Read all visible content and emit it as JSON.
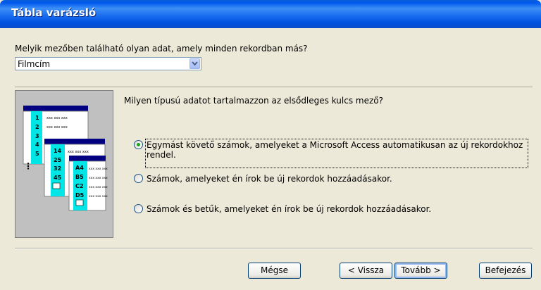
{
  "window": {
    "title": "Tábla varázsló"
  },
  "prompt": {
    "label": "Melyik mezőben található olyan adat, amely minden rekordban más?"
  },
  "field_select": {
    "value": "Filmcím"
  },
  "question": {
    "label": "Milyen típusú adatot tartalmazzon az elsődleges kulcs mező?"
  },
  "options": [
    {
      "line1": "Egymást követő számok, amelyeket a Microsoft Access automatikusan az új rekordokhoz",
      "line2": "rendel.",
      "selected": true
    },
    {
      "label": "Számok, amelyeket én írok be új rekordok hozzáadásakor.",
      "selected": false
    },
    {
      "label": "Számok és betűk, amelyeket én írok be új rekordok hozzáadásakor.",
      "selected": false
    }
  ],
  "illustration": {
    "t1": [
      "1",
      "2",
      "3",
      "4",
      "5"
    ],
    "t2": [
      "14",
      "25",
      "32",
      "45"
    ],
    "t3": [
      "A4",
      "B5",
      "C2",
      "D5"
    ],
    "cell": "xxx xxx xxx",
    "more": "⋮"
  },
  "buttons": {
    "cancel": "Mégse",
    "back": "< Vissza",
    "next": "Tovább >",
    "finish": "Befejezés"
  },
  "colors": {
    "title_bar": "#0054e3",
    "dialog": "#ece9d8",
    "radio_dot": "#21a121",
    "table_key": "#00e5e5"
  }
}
